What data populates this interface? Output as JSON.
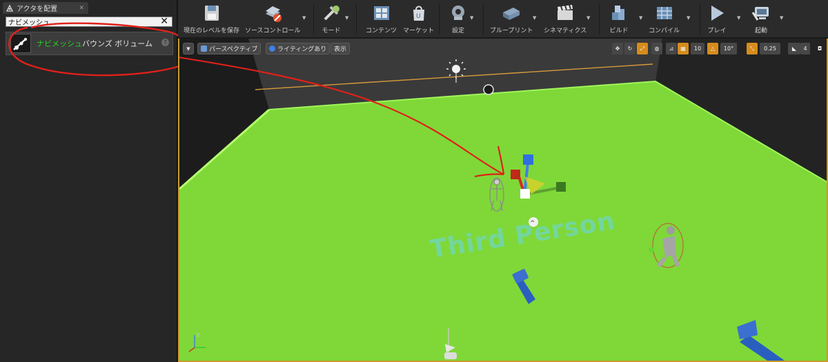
{
  "left_panel": {
    "tab_title": "アクタを配置",
    "search_value": "ナビメッシュ",
    "item": {
      "highlight": "ナビメッシュ",
      "rest": "バウンズ ボリューム"
    }
  },
  "toolbar": {
    "save_label": "現在のレベルを保存",
    "source_control_label": "ソースコントロール",
    "modes_label": "モード",
    "content_label": "コンテンツ",
    "marketplace_label": "マーケット",
    "settings_label": "設定",
    "blueprints_label": "ブループリント",
    "cinematics_label": "シネマティクス",
    "build_label": "ビルド",
    "compile_label": "コンパイル",
    "play_label": "プレイ",
    "launch_label": "起動"
  },
  "viewport": {
    "perspective_label": "パースペクティブ",
    "lighting_label": "ライティングあり",
    "show_label": "表示",
    "grid_snap_value": "10",
    "rotation_snap_value": "10°",
    "scale_snap_value": "0.25",
    "camera_speed_value": "4",
    "watermark_text": "Third Person"
  },
  "colors": {
    "floor": "#7fd838",
    "annotation": "#e0201a",
    "selection_border": "#c89b2c"
  }
}
